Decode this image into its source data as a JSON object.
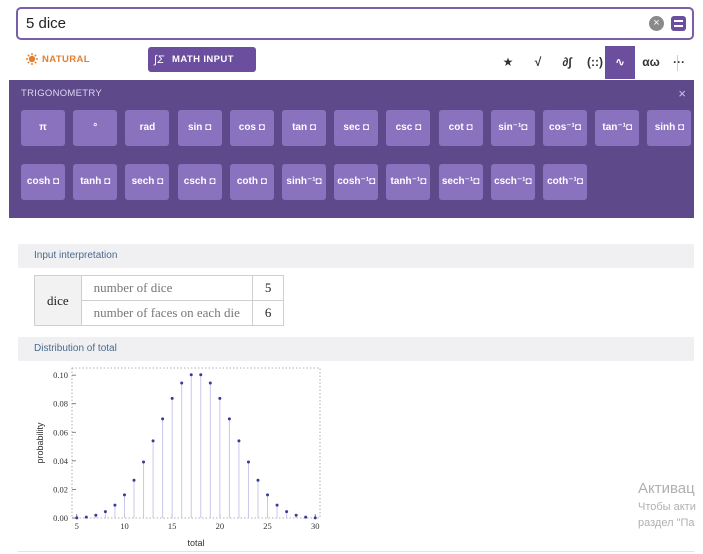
{
  "search": {
    "value": "5 dice"
  },
  "toolbar": {
    "natural_language": "NATURAL LANGUAGE",
    "math_input": "MATH INPUT",
    "math_input_icon": "∫Σ",
    "icons": [
      {
        "glyph": "★",
        "name": "favorite-star-icon"
      },
      {
        "glyph": "√",
        "name": "sqrt-icon"
      },
      {
        "glyph": "∂∫",
        "name": "calculus-icon"
      },
      {
        "glyph": "(::)",
        "name": "matrix-icon"
      },
      {
        "glyph": "∿",
        "name": "trig-wave-icon",
        "active": true
      },
      {
        "glyph": "αω",
        "name": "greek-letters-icon"
      },
      {
        "glyph": "···",
        "name": "more-icon"
      }
    ]
  },
  "trig_panel": {
    "title": "TRIGONOMETRY",
    "close": "×",
    "row1": [
      "π",
      "°",
      "rad",
      "sin ◘",
      "cos ◘",
      "tan ◘",
      "sec ◘",
      "csc ◘",
      "cot ◘",
      "sin⁻¹◘",
      "cos⁻¹◘",
      "tan⁻¹◘",
      "sinh ◘"
    ],
    "row2": [
      "cosh ◘",
      "tanh ◘",
      "sech ◘",
      "csch ◘",
      "coth ◘",
      "sinh⁻¹◘",
      "cosh⁻¹◘",
      "tanh⁻¹◘",
      "sech⁻¹◘",
      "csch⁻¹◘",
      "coth⁻¹◘"
    ]
  },
  "input_interpretation": {
    "title": "Input interpretation",
    "head": "dice",
    "rows": [
      {
        "label": "number of dice",
        "value": "5"
      },
      {
        "label": "number of faces on each die",
        "value": "6"
      }
    ]
  },
  "distribution": {
    "title": "Distribution of total"
  },
  "chart_data": {
    "type": "scatter",
    "style": "stem",
    "xlabel": "total",
    "ylabel": "probability",
    "xlim": [
      4.5,
      30.5
    ],
    "ylim": [
      0,
      0.105
    ],
    "xticks": [
      5,
      10,
      15,
      20,
      25,
      30
    ],
    "yticks": [
      0.0,
      0.02,
      0.04,
      0.06,
      0.08,
      0.1
    ],
    "ytick_labels": [
      "0.00",
      "0.02",
      "0.04",
      "0.06",
      "0.08",
      "0.10"
    ],
    "x": [
      5,
      6,
      7,
      8,
      9,
      10,
      11,
      12,
      13,
      14,
      15,
      16,
      17,
      18,
      19,
      20,
      21,
      22,
      23,
      24,
      25,
      26,
      27,
      28,
      29,
      30
    ],
    "y": [
      0.0001,
      0.0006,
      0.0019,
      0.0045,
      0.009,
      0.0162,
      0.0264,
      0.0392,
      0.054,
      0.0694,
      0.0837,
      0.0945,
      0.1003,
      0.1003,
      0.0945,
      0.0837,
      0.0694,
      0.054,
      0.0392,
      0.0264,
      0.0162,
      0.009,
      0.0045,
      0.0019,
      0.0006,
      0.0001
    ],
    "color": "#3a3a9a",
    "stem_color": "#c8c8ec"
  },
  "watermark": {
    "line1": "Активац",
    "line2": "Чтобы акти",
    "line3": "раздел \"Па"
  }
}
